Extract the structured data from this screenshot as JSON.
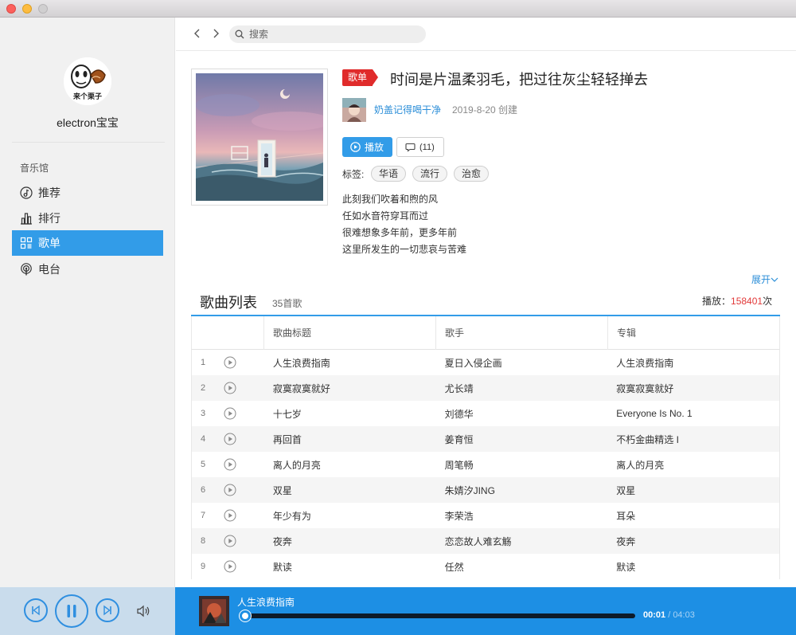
{
  "sidebar": {
    "username": "electron宝宝",
    "avatar_caption": "来个栗子",
    "section_heading": "音乐馆",
    "items": [
      {
        "label": "推荐",
        "icon": "music-note-icon",
        "active": false
      },
      {
        "label": "排行",
        "icon": "bar-chart-icon",
        "active": false
      },
      {
        "label": "歌单",
        "icon": "grid-icon",
        "active": true
      },
      {
        "label": "电台",
        "icon": "radio-icon",
        "active": false
      }
    ]
  },
  "topbar": {
    "search_placeholder": "搜索"
  },
  "playlist": {
    "badge": "歌单",
    "title": "时间是片温柔羽毛，把过往灰尘轻轻掸去",
    "creator": "奶盖记得喝干净",
    "created": "2019-8-20 创建",
    "play_label": "播放",
    "comment_count": "(11)",
    "tags_label": "标签:",
    "tags": [
      "华语",
      "流行",
      "治愈"
    ],
    "description": [
      "此刻我们吹着和煦的风",
      "任如水音符穿耳而过",
      "很难想象多年前，更多年前",
      "这里所发生的一切悲哀与苦难"
    ],
    "expand_label": "展开"
  },
  "song_list": {
    "title": "歌曲列表",
    "count": "35首歌",
    "play_count_label": "播放：",
    "play_count": "158401",
    "play_count_suffix": "次",
    "columns": [
      "",
      "歌曲标题",
      "歌手",
      "专辑"
    ],
    "rows": [
      {
        "index": "1",
        "title": "人生浪费指南",
        "artist": "夏日入侵企画",
        "album": "人生浪费指南"
      },
      {
        "index": "2",
        "title": "寂寞寂寞就好",
        "artist": "尤长靖",
        "album": "寂寞寂寞就好"
      },
      {
        "index": "3",
        "title": "十七岁",
        "artist": "刘德华",
        "album": "Everyone Is No. 1"
      },
      {
        "index": "4",
        "title": "再回首",
        "artist": "姜育恒",
        "album": "不朽金曲精选 I"
      },
      {
        "index": "5",
        "title": "离人的月亮",
        "artist": "周笔畅",
        "album": "离人的月亮"
      },
      {
        "index": "6",
        "title": "双星",
        "artist": "朱婧汐JING",
        "album": "双星"
      },
      {
        "index": "7",
        "title": "年少有为",
        "artist": "李荣浩",
        "album": "耳朵"
      },
      {
        "index": "8",
        "title": "夜奔",
        "artist": "恋恋故人难玄觞",
        "album": "夜奔"
      },
      {
        "index": "9",
        "title": "默读",
        "artist": "任然",
        "album": "默读"
      }
    ]
  },
  "player": {
    "now_playing": "人生浪费指南",
    "current_time": "00:01",
    "total_time": "/ 04:03",
    "progress_fraction": 0.004,
    "colors": {
      "accent": "#329ce8",
      "bar": "#1d8fe4"
    }
  }
}
